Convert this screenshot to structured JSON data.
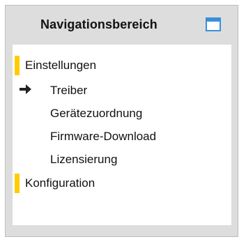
{
  "panel": {
    "title": "Navigationsbereich",
    "window_icon": "window-icon",
    "accent_color": "#ffcc00",
    "window_icon_color": "#3a8fd9"
  },
  "nav": {
    "items": [
      {
        "label": "Einstellungen",
        "level": 1,
        "marker": "yellow-bar"
      },
      {
        "label": "Treiber",
        "level": 2,
        "marker": "arrow-right-icon",
        "current": true
      },
      {
        "label": "Gerätezuordnung",
        "level": 2
      },
      {
        "label": "Firmware-Download",
        "level": 2
      },
      {
        "label": "Lizensierung",
        "level": 2
      },
      {
        "label": "Konfiguration",
        "level": 1,
        "marker": "yellow-bar"
      }
    ]
  }
}
